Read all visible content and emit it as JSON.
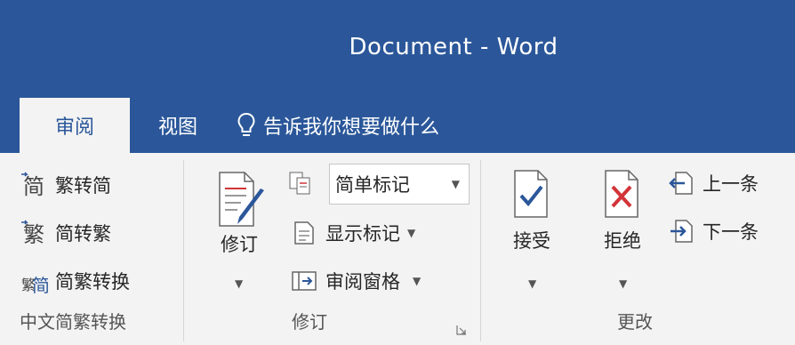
{
  "window": {
    "title": "Document - Word"
  },
  "tabs": {
    "active": "审阅",
    "view": "视图",
    "tell_me": "告诉我你想要做什么"
  },
  "groups": {
    "chinese_conversion": {
      "label": "中文简繁转换",
      "items": [
        "繁转简",
        "简转繁",
        "简繁转换"
      ]
    },
    "tracking": {
      "label": "修订",
      "track_changes": "修订",
      "markup_select": "简单标记",
      "show_markup": "显示标记",
      "reviewing_pane": "审阅窗格"
    },
    "changes": {
      "label": "更改",
      "accept": "接受",
      "reject": "拒绝",
      "previous": "上一条",
      "next": "下一条"
    }
  },
  "colors": {
    "brand": "#2b579a",
    "accept": "#2b579a",
    "reject": "#d13438"
  }
}
